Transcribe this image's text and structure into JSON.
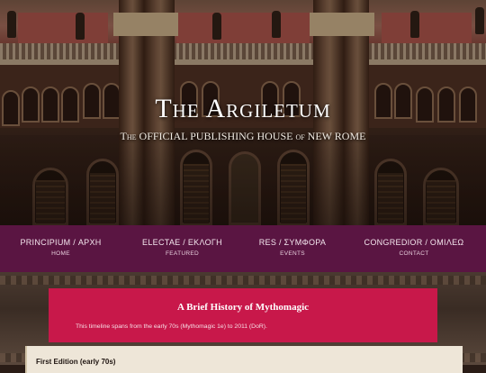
{
  "site": {
    "title": "The Argiletum",
    "subtitle": "The OFFICIAL PUBLISHING HOUSE of NEW ROME"
  },
  "nav": [
    {
      "label": "PRINCIPIUM / ΑΡΧΗ",
      "sub": "HOME"
    },
    {
      "label": "ELECTAE / ΕΚΛΟΓΗ",
      "sub": "FEATURED"
    },
    {
      "label": "RES / ΣΥΜΦΟΡΑ",
      "sub": "EVENTS"
    },
    {
      "label": "CONGREDIOR / ΟΜΙΛΕΩ",
      "sub": "CONTACT"
    }
  ],
  "banner": {
    "title": "A Brief History of Mythomagic",
    "text": "This timeline spans from the early 70s (Mythomagic 1e) to 2011 (DoR)."
  },
  "first_entry": {
    "title": "First Edition (early 70s)"
  },
  "colors": {
    "nav_bg": "#5a1542",
    "banner_bg": "#c8184a",
    "card_bg": "#eee6d8"
  }
}
